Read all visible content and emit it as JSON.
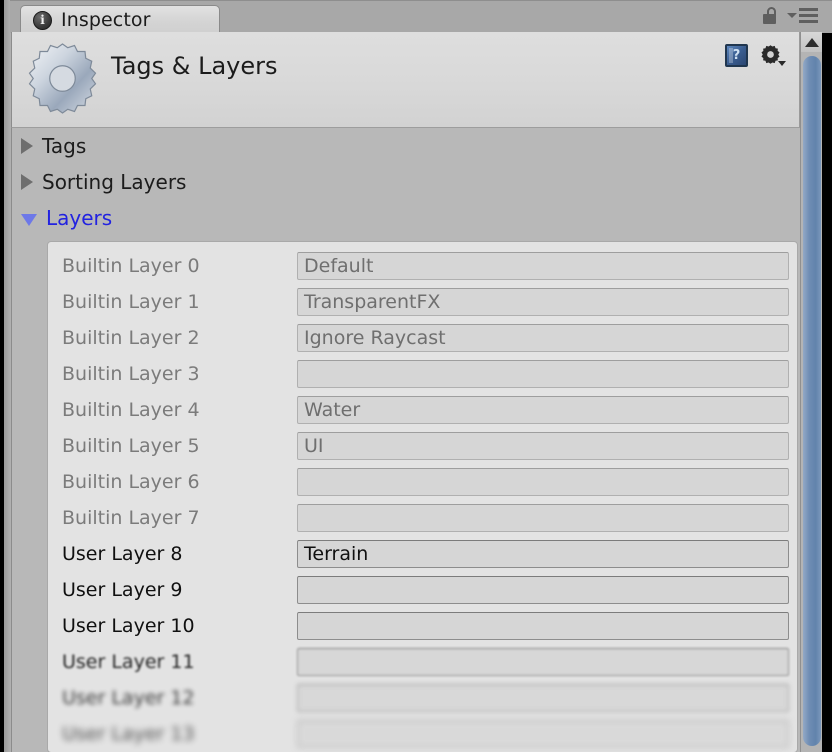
{
  "window": {
    "tab_label": "Inspector",
    "tab_icon": "info-circle-icon",
    "lock_icon": "lock-open-icon",
    "menu_icon": "hamburger-menu-icon"
  },
  "header": {
    "title": "Tags & Layers",
    "icon": "gear-asset-icon",
    "help_icon": "help-book-icon",
    "help_glyph": "?",
    "settings_icon": "gear-dropdown-icon"
  },
  "colors": {
    "accent_blue": "#2222e0",
    "scrollbar_thumb": "#6f8db4",
    "panel_bg": "#e3e3e3",
    "body_bg": "#b8b8b8"
  },
  "foldouts": [
    {
      "label": "Tags",
      "expanded": false
    },
    {
      "label": "Sorting Layers",
      "expanded": false
    },
    {
      "label": "Layers",
      "expanded": true
    }
  ],
  "layers": [
    {
      "name": "Builtin Layer 0",
      "value": "Default",
      "editable": false
    },
    {
      "name": "Builtin Layer 1",
      "value": "TransparentFX",
      "editable": false
    },
    {
      "name": "Builtin Layer 2",
      "value": "Ignore Raycast",
      "editable": false
    },
    {
      "name": "Builtin Layer 3",
      "value": "",
      "editable": false
    },
    {
      "name": "Builtin Layer 4",
      "value": "Water",
      "editable": false
    },
    {
      "name": "Builtin Layer 5",
      "value": "UI",
      "editable": false
    },
    {
      "name": "Builtin Layer 6",
      "value": "",
      "editable": false
    },
    {
      "name": "Builtin Layer 7",
      "value": "",
      "editable": false
    },
    {
      "name": "User Layer 8",
      "value": "Terrain",
      "editable": true
    },
    {
      "name": "User Layer 9",
      "value": "",
      "editable": true
    },
    {
      "name": "User Layer 10",
      "value": "",
      "editable": true
    },
    {
      "name": "User Layer 11",
      "value": "",
      "editable": true
    },
    {
      "name": "User Layer 12",
      "value": "",
      "editable": true
    },
    {
      "name": "User Layer 13",
      "value": "",
      "editable": true
    }
  ],
  "scrollbar": {
    "up_arrow_icon": "scroll-up-arrow-icon"
  }
}
